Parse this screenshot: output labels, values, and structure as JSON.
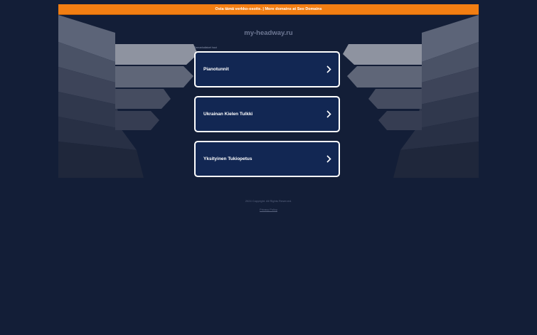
{
  "banner": {
    "buy_text": "Osta tämä verkko-osoite.",
    "separator": " | ",
    "more_text": "More domains at Seo Domains"
  },
  "domain": "my-headway.ru",
  "related_label": "Samankaltaiset haut",
  "links": [
    {
      "label": "Pianotunnit"
    },
    {
      "label": "Ukrainan Kielen Tulkki"
    },
    {
      "label": "Yksityinen Tukiopetus"
    }
  ],
  "footer": {
    "copyright": "2024 Copyright. All Rights Reserved.",
    "privacy": "Privacy Policy"
  },
  "colors": {
    "background": "#131e37",
    "banner": "#f27e12",
    "card": "#122753",
    "card_border": "#ffffff"
  },
  "icons": {
    "card_chevron": "chevron-right-icon"
  }
}
